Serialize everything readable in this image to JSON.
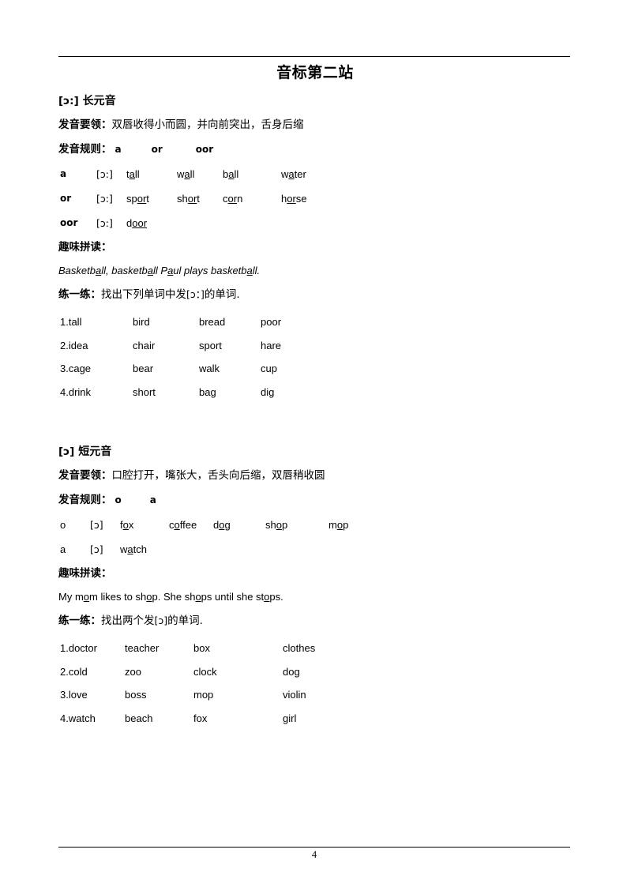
{
  "document": {
    "title": "音标第二站",
    "page_number": "4"
  },
  "section1": {
    "heading_ipa": "[ɔ:]",
    "heading_text": "长元音",
    "key_label": "发音要领：",
    "key_text": "双唇收得小而圆，并向前突出，舌身后缩",
    "rule_label": "发音规则：",
    "rule_letters": [
      "a",
      "or",
      "oor"
    ],
    "word_rows": [
      {
        "grapheme": "a",
        "ipa": "[ɔ:]",
        "words": [
          {
            "pre": "t",
            "mark": "a",
            "post": "ll"
          },
          {
            "pre": "w",
            "mark": "a",
            "post": "ll"
          },
          {
            "pre": "b",
            "mark": "a",
            "post": "ll"
          },
          {
            "pre": "w",
            "mark": "a",
            "post": "ter"
          }
        ]
      },
      {
        "grapheme": "or",
        "ipa": "[ɔ:]",
        "words": [
          {
            "pre": "sp",
            "mark": "or",
            "post": "t"
          },
          {
            "pre": "sh",
            "mark": "or",
            "post": "t"
          },
          {
            "pre": "c",
            "mark": "or",
            "post": "n"
          },
          {
            "pre": "h",
            "mark": "or",
            "post": "se"
          }
        ]
      },
      {
        "grapheme": "oor",
        "ipa": "[ɔ:]",
        "words": [
          {
            "pre": "d",
            "mark": "oor",
            "post": ""
          }
        ]
      }
    ],
    "fun_label": "趣味拼读：",
    "twister": [
      {
        "t": "Basketb",
        "u": false
      },
      {
        "t": "a",
        "u": true
      },
      {
        "t": "ll, basketb",
        "u": false
      },
      {
        "t": "a",
        "u": true
      },
      {
        "t": "ll P",
        "u": false
      },
      {
        "t": "a",
        "u": true
      },
      {
        "t": "ul plays basketb",
        "u": false
      },
      {
        "t": "a",
        "u": true
      },
      {
        "t": "ll.",
        "u": false
      }
    ],
    "practice_label": "练一练：",
    "practice_q_pre": "找出下列单词中发",
    "practice_q_ipa": "[ɔ：]",
    "practice_q_post": "的单词.",
    "grid": [
      [
        "1.tall",
        "bird",
        "bread",
        "poor"
      ],
      [
        "2.idea",
        "chair",
        "sport",
        "hare"
      ],
      [
        "3.cage",
        "bear",
        "walk",
        "cup"
      ],
      [
        "4.drink",
        "short",
        "bag",
        "dig"
      ]
    ]
  },
  "section2": {
    "heading_ipa": "[ɔ]",
    "heading_text": "短元音",
    "key_label": "发音要领：",
    "key_text": "口腔打开，嘴张大，舌头向后缩，双唇稍收圆",
    "rule_label": "发音规则：",
    "rule_letters": [
      "o",
      "a"
    ],
    "word_rows": [
      {
        "grapheme": "o",
        "ipa": "[ɔ]",
        "words": [
          {
            "pre": "f",
            "mark": "o",
            "post": "x"
          },
          {
            "pre": "c",
            "mark": "o",
            "post": "ffee"
          },
          {
            "pre": "d",
            "mark": "o",
            "post": "g"
          },
          {
            "pre": "sh",
            "mark": "o",
            "post": "p"
          },
          {
            "pre": "m",
            "mark": "o",
            "post": "p"
          }
        ]
      },
      {
        "grapheme": "a",
        "ipa": "[ɔ]",
        "words": [
          {
            "pre": "w",
            "mark": "a",
            "post": "tch"
          }
        ]
      }
    ],
    "fun_label": "趣味拼读：",
    "twister": [
      {
        "t": "My m",
        "u": false
      },
      {
        "t": "o",
        "u": true
      },
      {
        "t": "m likes to sh",
        "u": false
      },
      {
        "t": "o",
        "u": true
      },
      {
        "t": "p. She sh",
        "u": false
      },
      {
        "t": "o",
        "u": true
      },
      {
        "t": "ps until she st",
        "u": false
      },
      {
        "t": "o",
        "u": true
      },
      {
        "t": "ps.",
        "u": false
      }
    ],
    "practice_label": "练一练：",
    "practice_q_pre": "找出两个发",
    "practice_q_ipa": "[ɔ]",
    "practice_q_post": "的单词.",
    "grid": [
      [
        "1.doctor",
        "teacher",
        "box",
        "clothes"
      ],
      [
        "2.cold",
        "zoo",
        "clock",
        "dog"
      ],
      [
        "3.love",
        "boss",
        "mop",
        "violin"
      ],
      [
        "4.watch",
        "beach",
        "fox",
        "girl"
      ]
    ]
  }
}
